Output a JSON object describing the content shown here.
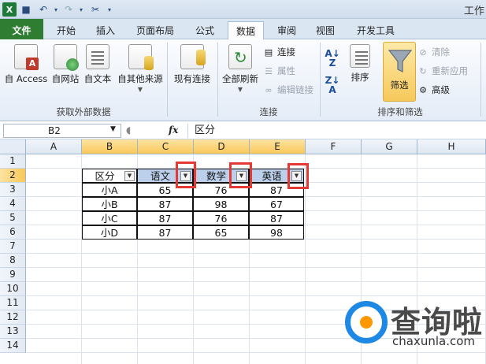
{
  "window": {
    "title": "工作"
  },
  "tabs": [
    {
      "label": "文件"
    },
    {
      "label": "开始"
    },
    {
      "label": "插入"
    },
    {
      "label": "页面布局"
    },
    {
      "label": "公式"
    },
    {
      "label": "数据"
    },
    {
      "label": "审阅"
    },
    {
      "label": "视图"
    },
    {
      "label": "开发工具"
    }
  ],
  "ribbon": {
    "external": {
      "access": "自 Access",
      "web": "自网站",
      "text": "自文本",
      "other": "自其他来源",
      "existing": "现有连接",
      "group_label": "获取外部数据"
    },
    "connections": {
      "refresh_all": "全部刷新",
      "connections": "连接",
      "properties": "属性",
      "edit_links": "编辑链接",
      "group_label": "连接"
    },
    "sort_filter": {
      "sort": "排序",
      "filter": "筛选",
      "clear": "清除",
      "reapply": "重新应用",
      "advanced": "高级",
      "group_label": "排序和筛选"
    }
  },
  "formula_bar": {
    "name_box": "B2",
    "fx": "fx",
    "content": "区分"
  },
  "sheet": {
    "columns": [
      "A",
      "B",
      "C",
      "D",
      "E",
      "F",
      "G",
      "H"
    ],
    "selected_columns": [
      "B",
      "C",
      "D",
      "E"
    ],
    "rows": [
      "1",
      "2",
      "3",
      "4",
      "5",
      "6",
      "7",
      "8",
      "9",
      "10",
      "11",
      "12",
      "13",
      "14"
    ],
    "selected_rows": [
      "2"
    ],
    "table": {
      "headers": [
        "区分",
        "语文",
        "数学",
        "英语"
      ],
      "rows": [
        [
          "小A",
          "65",
          "76",
          "87"
        ],
        [
          "小B",
          "87",
          "98",
          "67"
        ],
        [
          "小C",
          "87",
          "76",
          "87"
        ],
        [
          "小D",
          "87",
          "65",
          "98"
        ]
      ]
    }
  },
  "watermark": {
    "title": "查询啦",
    "subtitle": "chaxunla.com"
  },
  "colors": {
    "file_tab": "#2e7d32",
    "selection": "#f9c85a",
    "header_fill": "#bcd0ec",
    "highlight": "#e53935"
  }
}
